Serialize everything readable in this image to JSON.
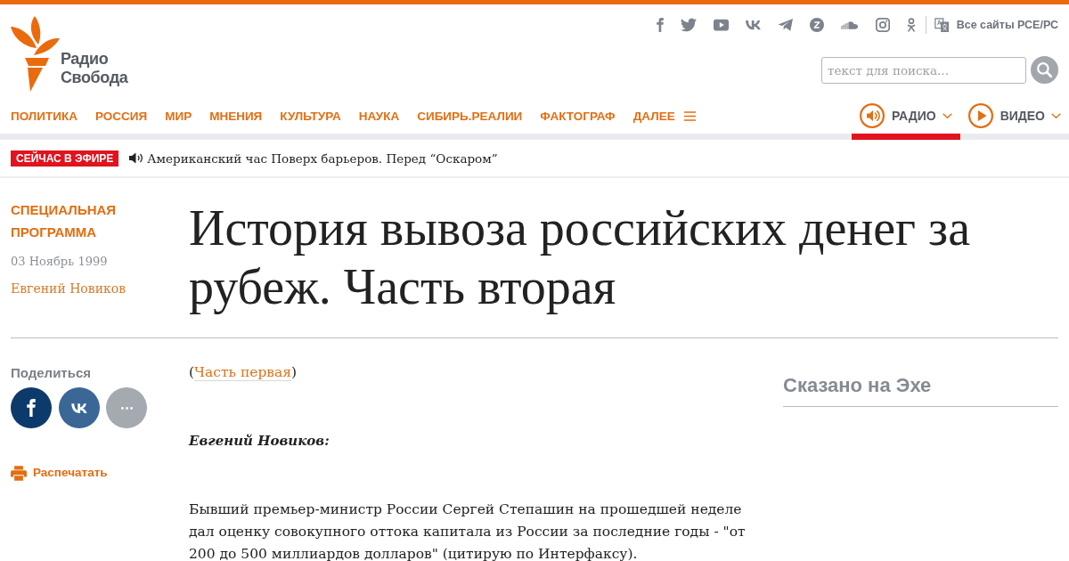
{
  "header": {
    "logo": {
      "text": "Радио Свобода"
    },
    "social_links": [
      {
        "kind": "facebook"
      },
      {
        "kind": "twitter"
      },
      {
        "kind": "youtube"
      },
      {
        "kind": "vk"
      },
      {
        "kind": "telegram"
      },
      {
        "kind": "zen"
      },
      {
        "kind": "soundcloud"
      },
      {
        "kind": "instagram"
      },
      {
        "kind": "ok"
      }
    ],
    "all_sites": "Все сайты РСЕ/РС",
    "search": {
      "placeholder": "текст для поиска..."
    }
  },
  "nav": {
    "items": [
      "ПОЛИТИКА",
      "РОССИЯ",
      "МИР",
      "МНЕНИЯ",
      "КУЛЬТУРА",
      "НАУКА",
      "СИБИРЬ.РЕАЛИИ",
      "ФАКТОГРАФ"
    ],
    "more": "ДАЛЕЕ",
    "media": [
      {
        "label": "РАДИО",
        "kind": "radio",
        "selected": true
      },
      {
        "label": "ВИДЕО",
        "kind": "video",
        "selected": false
      }
    ]
  },
  "live": {
    "badge": "СЕЙЧАС В ЭФИРЕ",
    "text": "Американский час Поверх барьеров. Перед “Оскаром”"
  },
  "article": {
    "category": "СПЕЦИАЛЬНАЯ ПРОГРАММА",
    "date": "03 Ноябрь 1999",
    "author": "Евгений Новиков",
    "title": "История вывоза российских денег за рубеж. Часть вторая",
    "share": {
      "label": "Поделиться",
      "buttons": [
        {
          "kind": "facebook"
        },
        {
          "kind": "vk"
        },
        {
          "kind": "more"
        }
      ]
    },
    "print": "Распечатать",
    "part_link": {
      "before": "(",
      "link": "Часть первая",
      "after": ")"
    },
    "speaker": "Евгений Новиков:",
    "paragraphs": [
      "Бывший премьер-министр России Сергей Степашин на прошедшей неделе дал оценку совокупного оттока капитала из России за последние годы - \"от 200 до 500 миллиардов долларов\" (цитирую по Интерфаксу)."
    ]
  },
  "sidebar": {
    "title": "Сказано на Эхе"
  }
}
